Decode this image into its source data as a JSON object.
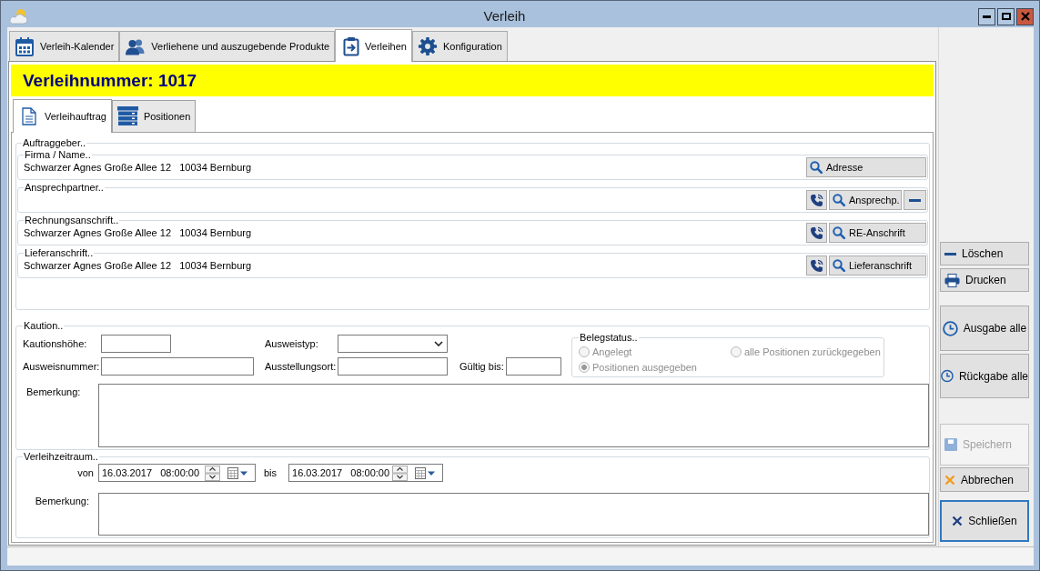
{
  "window": {
    "title": "Verleih"
  },
  "tabs": [
    {
      "label": "Verleih-Kalender",
      "selected": false
    },
    {
      "label": "Verliehene und auszugebende Produkte",
      "selected": false
    },
    {
      "label": "Verleihen",
      "selected": true
    },
    {
      "label": "Konfiguration",
      "selected": false
    }
  ],
  "banner": {
    "title": "Verleihnummer: 1017"
  },
  "subtabs": [
    {
      "label": "Verleihauftrag",
      "selected": true
    },
    {
      "label": "Positionen",
      "selected": false
    }
  ],
  "client": {
    "legend": "Auftraggeber..",
    "sections": [
      {
        "legend": "Firma / Name..",
        "address": "Schwarzer Agnes Große Allee 12   10034 Bernburg",
        "buttons": [
          {
            "kind": "search",
            "label": "Adresse"
          }
        ]
      },
      {
        "legend": "Ansprechpartner..",
        "buttons": [
          {
            "kind": "phone"
          },
          {
            "kind": "search",
            "label": "Ansprechp."
          },
          {
            "kind": "remove"
          }
        ]
      },
      {
        "legend": "Rechnungsanschrift..",
        "address": "Schwarzer Agnes Große Allee 12   10034 Bernburg",
        "buttons": [
          {
            "kind": "phone"
          },
          {
            "kind": "search",
            "label": "RE-Anschrift"
          }
        ]
      },
      {
        "legend": "Lieferanschrift..",
        "address": "Schwarzer Agnes Große Allee 12   10034 Bernburg",
        "buttons": [
          {
            "kind": "phone"
          },
          {
            "kind": "search",
            "label": "Lieferanschrift"
          }
        ]
      }
    ]
  },
  "deposit": {
    "legend": "Kaution..",
    "amount": {
      "label": "Kautionshöhe:"
    },
    "id_type": {
      "label": "Ausweistyp:"
    },
    "id_number": {
      "label": "Ausweisnummer:"
    },
    "issued_at": {
      "label": "Ausstellungsort:"
    },
    "valid_until": {
      "label": "Gültig bis:"
    },
    "document_status": {
      "legend": "Belegstatus..",
      "disabled": true,
      "options": [
        {
          "label": "Angelegt",
          "selected": false
        },
        {
          "label": "alle Positionen zurückgegeben",
          "selected": false
        },
        {
          "label": "Positionen ausgegeben",
          "selected": true
        }
      ]
    },
    "remark": {
      "label": "Bemerkung:"
    }
  },
  "period": {
    "legend": "Verleihzeitraum..",
    "from": {
      "label": "von",
      "value": "16.03.2017   08:00:00"
    },
    "to": {
      "label": "bis",
      "value": "16.03.2017   08:00:00"
    },
    "remark": {
      "label": "Bemerkung:"
    }
  },
  "actions": [
    {
      "kind": "delete",
      "label": "Löschen",
      "disabled": false,
      "default": false
    },
    {
      "kind": "print",
      "label": "Drucken",
      "disabled": false,
      "default": false
    },
    {
      "kind": "issue_all",
      "label": "Ausgabe alle",
      "disabled": false,
      "default": false
    },
    {
      "kind": "return_all",
      "label": "Rückgabe alle",
      "disabled": false,
      "default": false
    },
    {
      "kind": "save",
      "label": "Speichern",
      "disabled": true,
      "default": false
    },
    {
      "kind": "cancel",
      "label": "Abbrechen",
      "disabled": false,
      "default": false
    },
    {
      "kind": "close",
      "label": "Schließen",
      "disabled": false,
      "default": true
    }
  ]
}
